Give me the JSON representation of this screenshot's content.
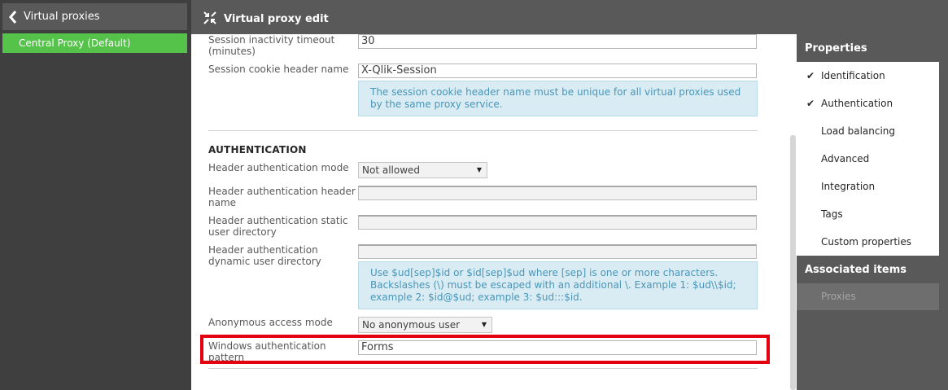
{
  "sidebar": {
    "back_label": "Virtual proxies",
    "selected_item": "Central Proxy (Default)"
  },
  "header": {
    "title": "Virtual proxy edit"
  },
  "form": {
    "session_timeout": {
      "label": "Session inactivity timeout (minutes)",
      "value": "30"
    },
    "cookie_header": {
      "label": "Session cookie header name",
      "value": "X-Qlik-Session",
      "info": "The session cookie header name must be unique for all virtual proxies used by the same proxy service."
    },
    "auth_section_title": "AUTHENTICATION",
    "header_auth_mode": {
      "label": "Header authentication mode",
      "value": "Not allowed"
    },
    "header_auth_header_name": {
      "label": "Header authentication header name",
      "value": ""
    },
    "header_auth_static_dir": {
      "label": "Header authentication static user directory",
      "value": ""
    },
    "header_auth_dynamic_dir": {
      "label": "Header authentication dynamic user directory",
      "value": "",
      "info": "Use $ud[sep]$id or $id[sep]$ud where [sep] is one or more characters. Backslashes (\\) must be escaped with an additional \\. Example 1: $ud\\\\$id; example 2: $id@$ud; example 3: $ud:::$id."
    },
    "anonymous_access": {
      "label": "Anonymous access mode",
      "value": "No anonymous user"
    },
    "windows_auth_pattern": {
      "label": "Windows authentication pattern",
      "value": "Forms"
    }
  },
  "properties": {
    "title": "Properties",
    "items": [
      {
        "label": "Identification",
        "checked": true
      },
      {
        "label": "Authentication",
        "checked": true
      },
      {
        "label": "Load balancing",
        "checked": false
      },
      {
        "label": "Advanced",
        "checked": false
      },
      {
        "label": "Integration",
        "checked": false
      },
      {
        "label": "Tags",
        "checked": false
      },
      {
        "label": "Custom properties",
        "checked": false
      }
    ],
    "check_glyph": "✔"
  },
  "associated": {
    "title": "Associated items",
    "items": [
      {
        "label": "Proxies"
      }
    ]
  },
  "colors": {
    "accent_green": "#55c24a",
    "highlight_red": "#e3000f",
    "info_bg": "#d9ecf3",
    "info_text": "#4a96b8"
  },
  "icons": {
    "back": "chevron-left-icon",
    "header": "arrows-compress-icon",
    "dropdown": "triangle-down-icon"
  }
}
